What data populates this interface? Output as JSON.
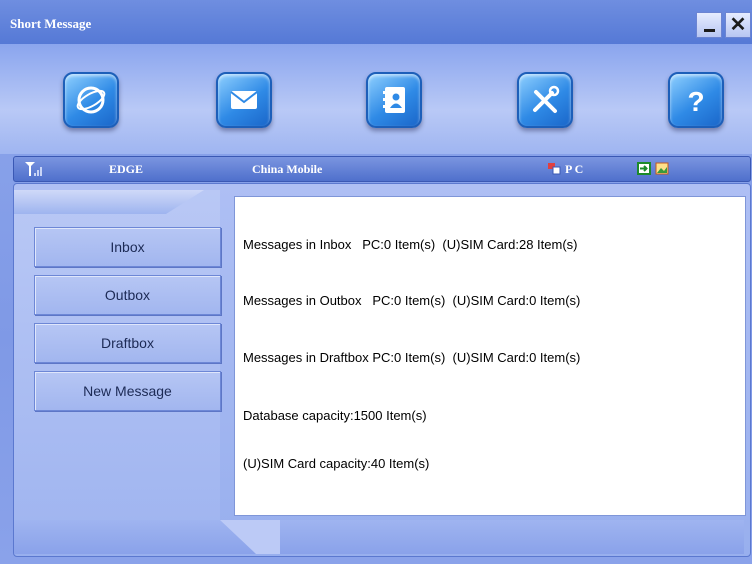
{
  "window": {
    "title": "Short Message"
  },
  "controls": {
    "minimize_icon": "minimize-icon",
    "close_label": "✕"
  },
  "toolbar": {
    "items": [
      {
        "icon": "internet-icon"
      },
      {
        "icon": "message-icon"
      },
      {
        "icon": "contacts-icon"
      },
      {
        "icon": "settings-icon"
      },
      {
        "icon": "help-icon",
        "label": "?"
      }
    ]
  },
  "status": {
    "network": "EDGE",
    "operator": "China Mobile",
    "pc_label": "P C"
  },
  "nav": {
    "inbox": "Inbox",
    "outbox": "Outbox",
    "draftbox": "Draftbox",
    "new_message": "New Message"
  },
  "info": {
    "inbox": "Messages in Inbox   PC:0 Item(s)  (U)SIM Card:28 Item(s)",
    "outbox": "Messages in Outbox   PC:0 Item(s)  (U)SIM Card:0 Item(s)",
    "draftbox": "Messages in Draftbox PC:0 Item(s)  (U)SIM Card:0 Item(s)",
    "database_capacity": "Database capacity:1500 Item(s)",
    "sim_capacity": "(U)SIM Card capacity:40 Item(s)"
  },
  "colors": {
    "accent": "#5579d6",
    "panel": "#aebff4",
    "icon_blue": "#2f8ae6"
  }
}
